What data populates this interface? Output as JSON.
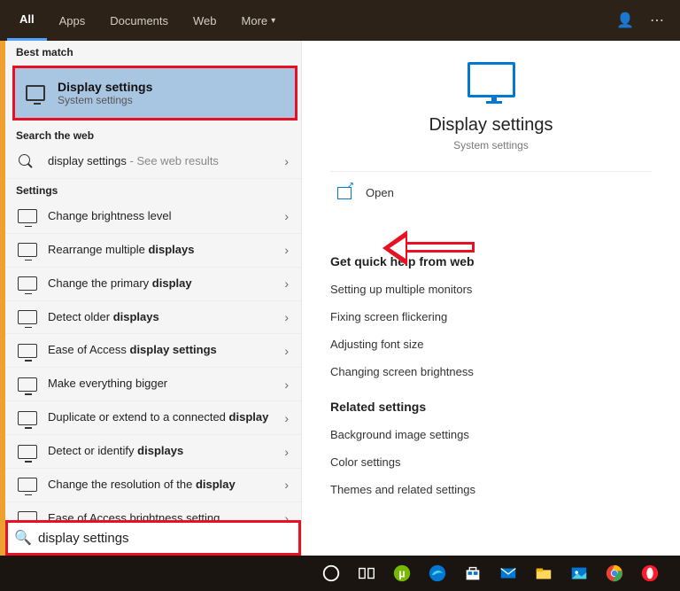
{
  "topbar": {
    "tabs": [
      "All",
      "Apps",
      "Documents",
      "Web",
      "More"
    ]
  },
  "left": {
    "bestMatchHeader": "Best match",
    "bestMatch": {
      "title": "Display settings",
      "sub": "System settings"
    },
    "webHeader": "Search the web",
    "webRow": {
      "label": "display settings",
      "sub": " - See web results"
    },
    "settingsHeader": "Settings",
    "settings": [
      "Change brightness level",
      "Rearrange multiple displays",
      "Change the primary display",
      "Detect older displays",
      "Ease of Access display settings",
      "Make everything bigger",
      "Duplicate or extend to a connected display",
      "Detect or identify displays",
      "Change the resolution of the display",
      "Ease of Access brightness setting"
    ]
  },
  "preview": {
    "title": "Display settings",
    "sub": "System settings",
    "open": "Open"
  },
  "help": {
    "quickHeader": "Get quick help from web",
    "quick": [
      "Setting up multiple monitors",
      "Fixing screen flickering",
      "Adjusting font size",
      "Changing screen brightness"
    ],
    "relatedHeader": "Related settings",
    "related": [
      "Background image settings",
      "Color settings",
      "Themes and related settings"
    ]
  },
  "search": {
    "value": "display settings"
  }
}
